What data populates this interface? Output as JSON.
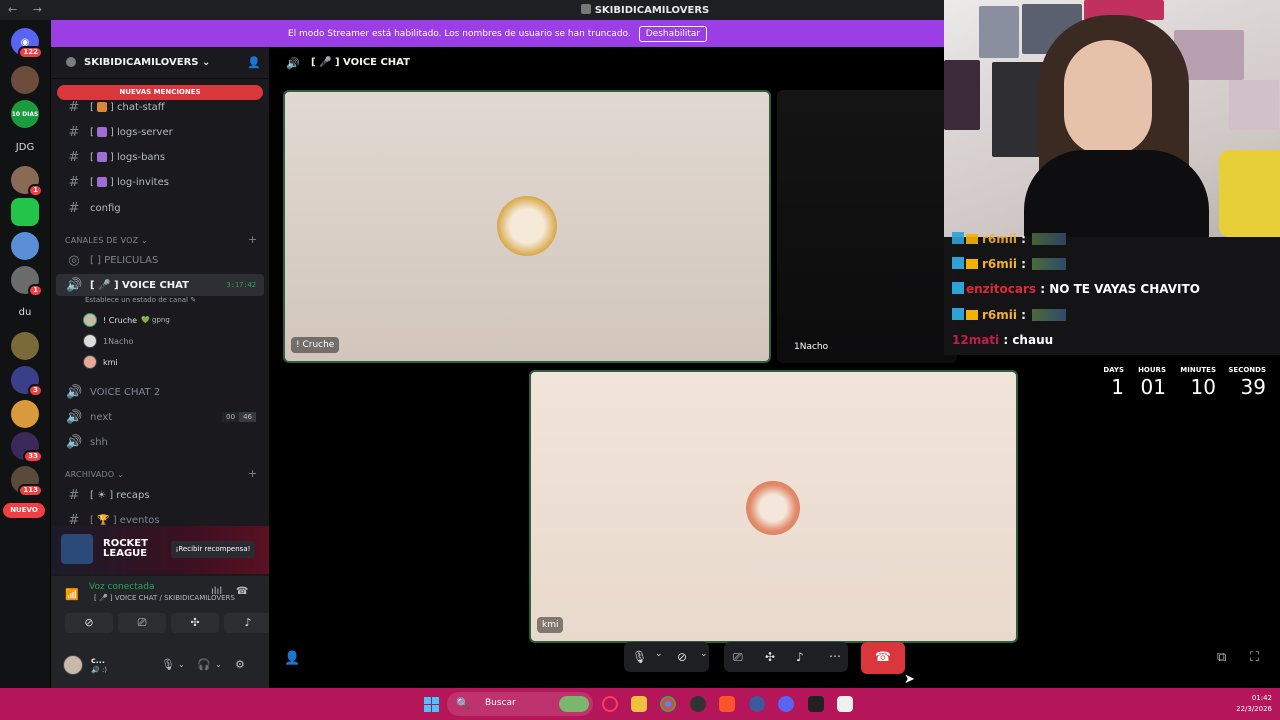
{
  "window": {
    "title": "SKIBIDICAMILOVERS",
    "nav": "← →"
  },
  "server_rail": {
    "badges": [
      "122",
      "1",
      "1",
      "3",
      "33",
      "113"
    ],
    "text_servers": [
      "JDG",
      "du"
    ],
    "new_label": "NUEVO",
    "dias_label": "10 DIAS"
  },
  "banner": {
    "text": "El modo Streamer está habilitado. Los nombres de usuario se han truncado.",
    "button": "Deshabilitar"
  },
  "sidebar": {
    "server_name": "SKIBIDICAMILOVERS ⌄",
    "mentions": "NUEVAS MENCIONES",
    "text_channels": [
      {
        "prefix": "[",
        "suffix": "]",
        "name": "chat-staff"
      },
      {
        "prefix": "[",
        "suffix": "]",
        "name": "logs-server"
      },
      {
        "prefix": "[",
        "suffix": "]",
        "name": "logs-bans"
      },
      {
        "prefix": "[",
        "suffix": "]",
        "name": "log-invites"
      },
      {
        "prefix": "",
        "suffix": "",
        "name": "config"
      }
    ],
    "voice_category": "CANALES DE VOZ ⌄",
    "peliculas": "[ ] PELICULAS",
    "active_channel": "[ 🎤 ] VOICE CHAT",
    "active_time": "3:17:42",
    "status_hint": "Establece un estado de canal ✎",
    "voice_users": [
      {
        "name": "! Cruche",
        "tag": "💚 gpng"
      },
      {
        "name": "1Nacho",
        "tag": ""
      },
      {
        "name": "kmi",
        "tag": ""
      }
    ],
    "voice_chat_2": "VOICE CHAT 2",
    "next": "next",
    "next_counts": [
      "00",
      "46"
    ],
    "shh": "shh",
    "archived_category": "ARCHIVADO ⌄",
    "recaps": "[ ☀ ] recaps",
    "eventos": "[ 🏆 ] eventos"
  },
  "promo": {
    "brand": "ROCKET LEAGUE",
    "cta": "¡Recibir recompensa!"
  },
  "voice_panel": {
    "status": "Voz conectada",
    "location": "[ 🎤 ] VOICE CHAT / SKIBIDICAMILOVERS",
    "user_name": "c...",
    "user_status": "🔊 :)"
  },
  "main": {
    "channel_title": "[ 🎤 ] VOICE CHAT",
    "tiles": [
      {
        "label": "! Cruche"
      },
      {
        "label": "1Nacho"
      },
      {
        "label": "kmi"
      }
    ]
  },
  "chat": [
    {
      "user": "r6mii",
      "color": "#f3b02a",
      "message": "",
      "emote": true,
      "badges": true
    },
    {
      "user": "r6mii",
      "color": "#f3b02a",
      "message": "",
      "emote": true,
      "badges": true
    },
    {
      "user": "enzitocars",
      "color": "#e2263a",
      "message": "NO TE VAYAS CHAVITO",
      "emote": false,
      "badges": true
    },
    {
      "user": "r6mii",
      "color": "#f3b02a",
      "message": "",
      "emote": true,
      "badges": true
    },
    {
      "user": "12mati",
      "color": "#c61b4a",
      "message": "chauu",
      "emote": false,
      "badges": false
    }
  ],
  "countdown": [
    {
      "label": "DAYS",
      "value": "1"
    },
    {
      "label": "HOURS",
      "value": "01"
    },
    {
      "label": "MINUTES",
      "value": "10"
    },
    {
      "label": "SECONDS",
      "value": "39"
    }
  ],
  "taskbar": {
    "search": "Buscar",
    "time": "01:42",
    "date": "22/3/2026"
  },
  "colors": {
    "banner": "#9b3ee6",
    "taskbar": "#b5165a",
    "connected": "#23a55a",
    "danger": "#da373c"
  }
}
